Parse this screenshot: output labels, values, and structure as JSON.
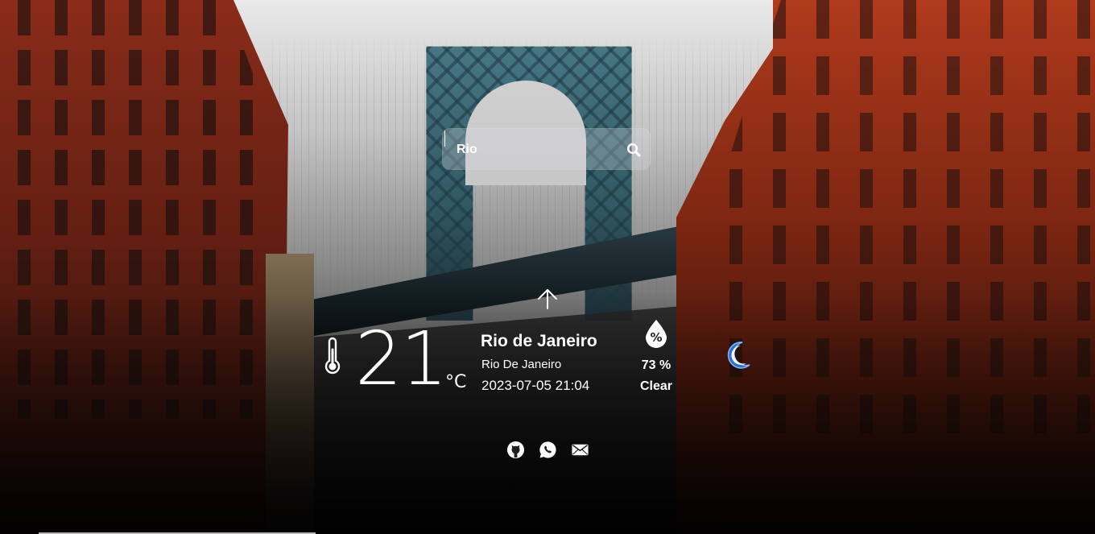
{
  "search": {
    "value": "Rio",
    "placeholder": ""
  },
  "weather": {
    "temperature": "21",
    "unit": "°C",
    "city": "Rio de Janeiro",
    "region": "Rio De Janeiro",
    "datetime": "2023-07-05 21:04",
    "humidity": "73 %",
    "condition": "Clear",
    "condition_icon": "moon-icon",
    "wind_direction_icon": "arrow-up-icon"
  },
  "socials": {
    "items": [
      "github-icon",
      "whatsapp-icon",
      "mail-icon"
    ]
  },
  "colors": {
    "text": "#ffffff",
    "moon": "#3b82d6",
    "search_bg": "rgba(220,220,225,0.30)"
  }
}
